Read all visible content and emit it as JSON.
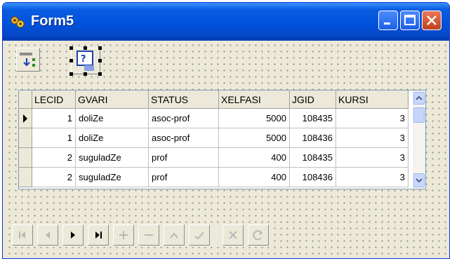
{
  "window": {
    "title": "Form5"
  },
  "grid": {
    "columns": [
      "LECID",
      "GVARI",
      "STATUS",
      "XELFASI",
      "JGID",
      "KURSI"
    ],
    "rows": [
      [
        "1",
        "doliZe",
        "asoc-prof",
        "5000",
        "108435",
        "3"
      ],
      [
        "1",
        "doliZe",
        "asoc-prof",
        "5000",
        "108436",
        "3"
      ],
      [
        "2",
        "suguladZe",
        "prof",
        "400",
        "108435",
        "3"
      ],
      [
        "2",
        "suguladZe",
        "prof",
        "400",
        "108436",
        "3"
      ]
    ],
    "current_row": 0
  },
  "navigator": {
    "buttons": [
      {
        "name": "first",
        "enabled": false
      },
      {
        "name": "prior",
        "enabled": false
      },
      {
        "name": "next",
        "enabled": true
      },
      {
        "name": "last",
        "enabled": true
      },
      {
        "name": "insert",
        "enabled": false
      },
      {
        "name": "delete",
        "enabled": false
      },
      {
        "name": "edit",
        "enabled": false
      },
      {
        "name": "post",
        "enabled": false
      },
      {
        "name": "cancel",
        "enabled": false
      },
      {
        "name": "refresh",
        "enabled": false
      }
    ]
  },
  "colors": {
    "title_bar": "#0052dc",
    "form_bg": "#ece9d8"
  }
}
